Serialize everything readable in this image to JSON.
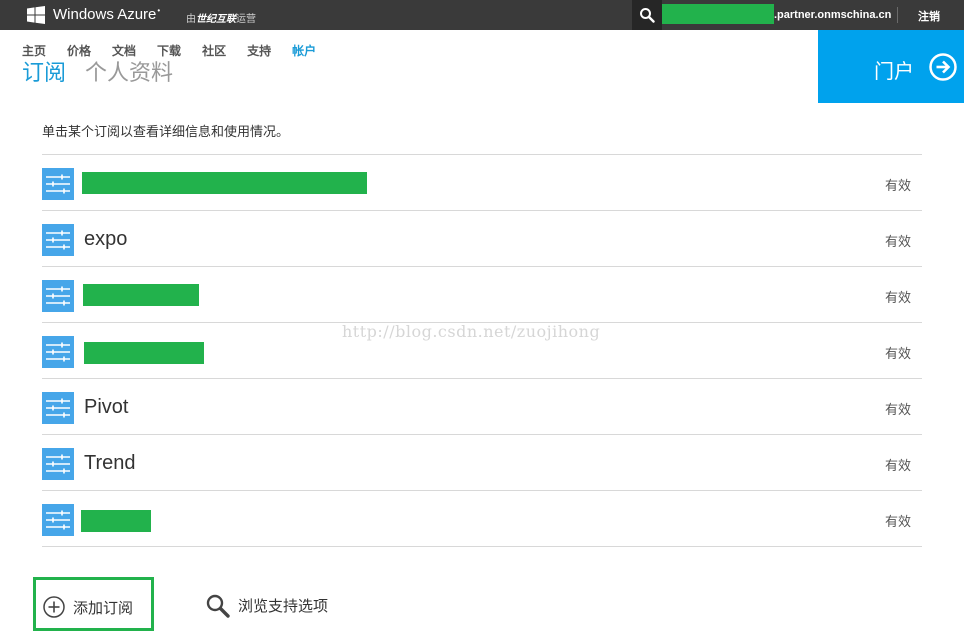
{
  "topbar": {
    "brand": "Windows Azure",
    "brand_sup": "•",
    "operator_prefix": "由",
    "operator_name": "世纪互联",
    "operator_suffix": "运营",
    "account_domain": ".partner.onmschina.cn",
    "signout_label": "注销"
  },
  "nav": {
    "items": [
      "主页",
      "价格",
      "文档",
      "下载",
      "社区",
      "支持",
      "帐户"
    ]
  },
  "page_tabs": [
    "订阅",
    "个人资料"
  ],
  "portal": {
    "label": "门户"
  },
  "instruction": "单击某个订阅以查看详细信息和使用情况。",
  "subscriptions": [
    {
      "name": "",
      "status": "有效"
    },
    {
      "name": "expo",
      "status": "有效"
    },
    {
      "name": "",
      "status": "有效"
    },
    {
      "name": "",
      "status": "有效"
    },
    {
      "name": "Pivot",
      "status": "有效"
    },
    {
      "name": "Trend",
      "status": "有效"
    },
    {
      "name": "",
      "status": "有效"
    }
  ],
  "watermark": "http://blog.csdn.net/zuojihong",
  "actions": {
    "add_subscription": "添加订阅",
    "browse_support": "浏览支持选项"
  },
  "colors": {
    "accent": "#1a9bd7",
    "portal_bg": "#00a2ed",
    "row_icon_bg": "#46a6e9",
    "redaction": "#22b24c",
    "topbar_bg": "#3a3a3a"
  }
}
